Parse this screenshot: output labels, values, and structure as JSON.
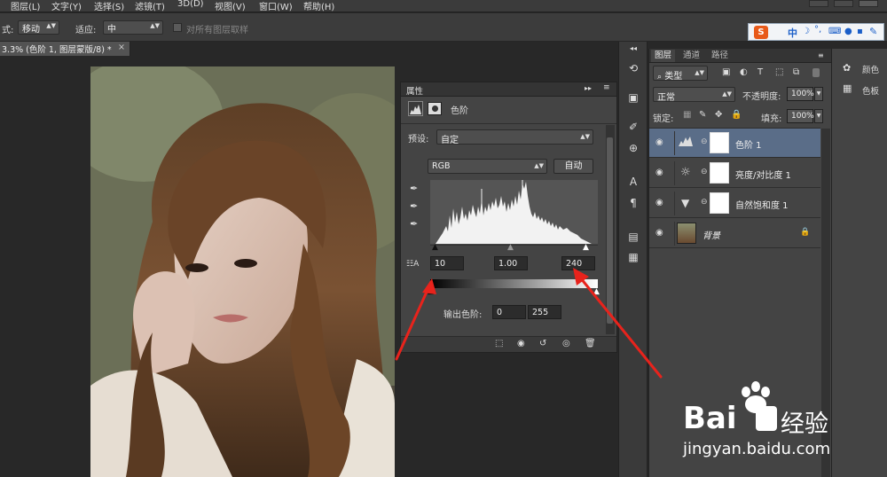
{
  "menu": {
    "items": [
      "图层(L)",
      "文字(Y)",
      "选择(S)",
      "滤镜(T)",
      "3D(D)",
      "视图(V)",
      "窗口(W)",
      "帮助(H)"
    ]
  },
  "options_bar": {
    "mode_label": "式:",
    "tool_select": "移动",
    "fit_label": "适应:",
    "fit_select": "中",
    "sample_all_label": "对所有图层取样"
  },
  "document_tab": {
    "title": "3.3% (色阶 1, 图层蒙版/8) *",
    "close": "×"
  },
  "ime": {
    "lang": "中",
    "logo": "S"
  },
  "properties": {
    "tab_label": "属性",
    "panel_title": "色阶",
    "preset_label": "预设:",
    "preset_value": "自定",
    "channel_value": "RGB",
    "auto_button": "自动",
    "input_black": "10",
    "input_gamma": "1.00",
    "input_white": "240",
    "output_label": "输出色阶:",
    "output_black": "0",
    "output_white": "255"
  },
  "layers_panel": {
    "tabs": [
      "图层",
      "通道",
      "路径"
    ],
    "filter_label": "类型",
    "blend_mode": "正常",
    "opacity_label": "不透明度:",
    "opacity_value": "100%",
    "lock_label": "锁定:",
    "fill_label": "填充:",
    "fill_value": "100%",
    "layers": [
      {
        "name": "色阶 1",
        "selected": true,
        "icon": "levels-icon"
      },
      {
        "name": "亮度/对比度 1",
        "selected": false,
        "icon": "brightness-icon"
      },
      {
        "name": "自然饱和度 1",
        "selected": false,
        "icon": "vibrance-icon"
      },
      {
        "name": "背景",
        "selected": false,
        "icon": "photo-thumb"
      }
    ]
  },
  "right_panel": {
    "items": [
      "颜色",
      "色板"
    ]
  },
  "watermark": {
    "brand": "Bai",
    "brand_cn": "经验",
    "url": "jingyan.baidu.com"
  },
  "colors": {
    "selected_layer": "#5a6d88",
    "annotation_arrow": "#e8231c",
    "panel_bg": "#444444"
  }
}
